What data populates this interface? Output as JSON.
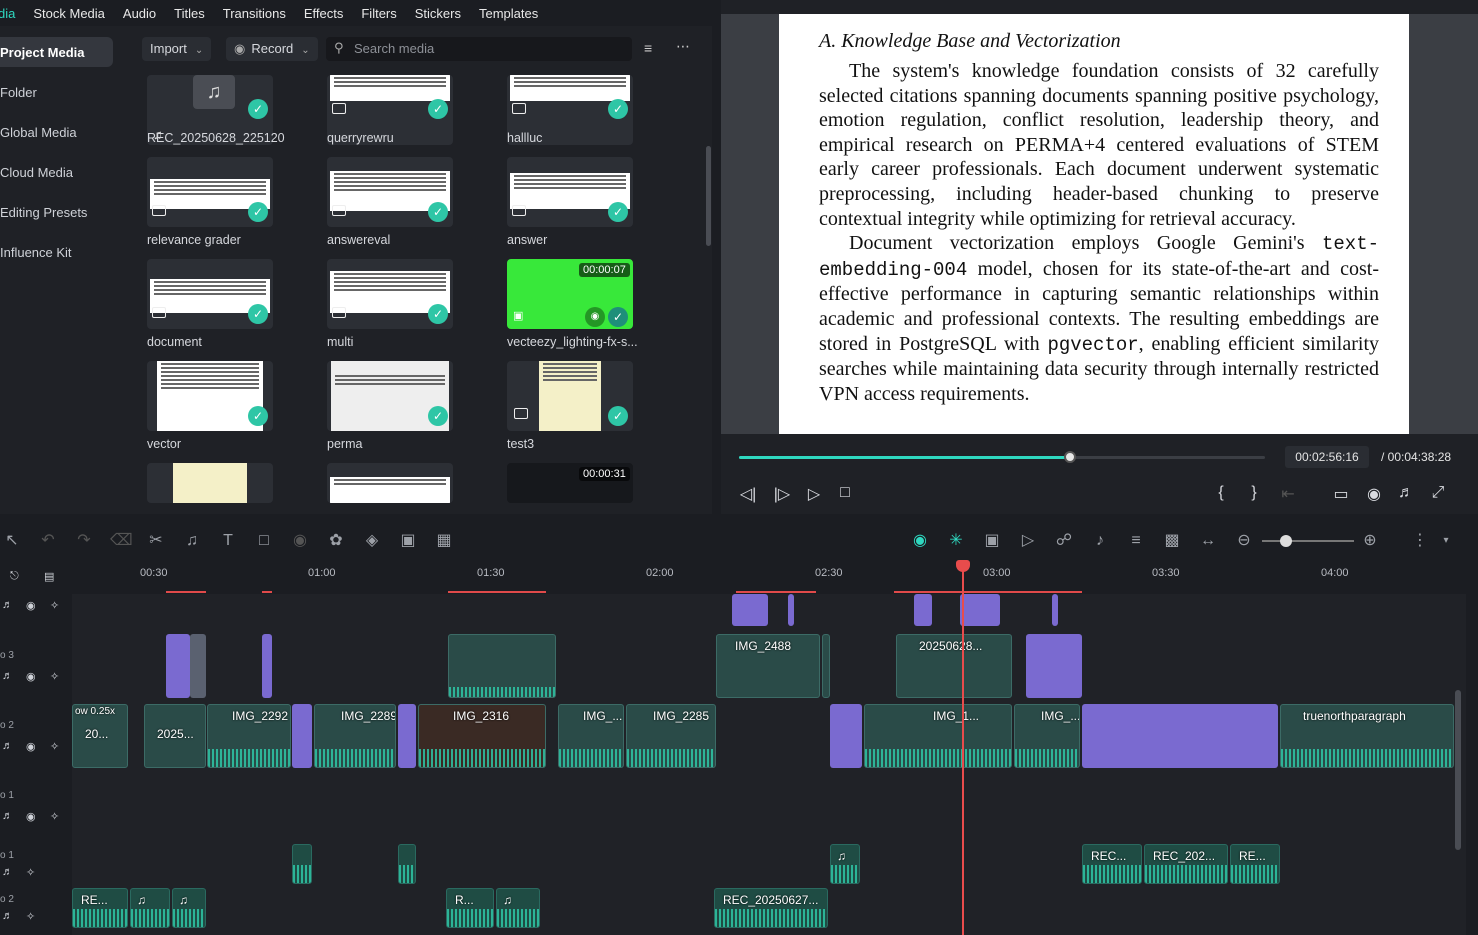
{
  "top_tabs": [
    "dia",
    "Stock Media",
    "Audio",
    "Titles",
    "Transitions",
    "Effects",
    "Filters",
    "Stickers",
    "Templates"
  ],
  "sidebar": [
    "Project Media",
    "Folder",
    "Global Media",
    "Cloud Media",
    "Editing Presets",
    "Influence Kit"
  ],
  "media_toolbar": {
    "import": "Import",
    "record": "Record",
    "search_placeholder": "Search media"
  },
  "media_items": [
    {
      "label": "REC_20250628_225120"
    },
    {
      "label": "querryrewru"
    },
    {
      "label": "hallluc"
    },
    {
      "label": "relevance grader"
    },
    {
      "label": "answereval"
    },
    {
      "label": "answer"
    },
    {
      "label": "document"
    },
    {
      "label": "multi"
    },
    {
      "label": "vecteezy_lighting-fx-s...",
      "duration": "00:00:07"
    },
    {
      "label": "vector"
    },
    {
      "label": "perma"
    },
    {
      "label": "test3"
    },
    {
      "label": "",
      "duration": "00:00:31"
    }
  ],
  "preview_doc": {
    "heading": "A. Knowledge Base and Vectorization",
    "p1": "The system's knowledge foundation consists of 32 carefully selected citations spanning documents spanning positive psychology, emotion regulation, conflict resolution, leadership theory, and empirical research on PERMA+4 centered evaluations of STEM early career professionals. Each document underwent systematic preprocessing, including header-based chunking to preserve contextual integrity while optimizing for retrieval accuracy.",
    "p2a": "Document vectorization employs Google Gemini's ",
    "p2code": "text-embedding-004",
    "p2b": " model, chosen for its state-of-the-art and cost-effective performance in capturing semantic relationships within academic and professional contexts. The resulting embeddings are stored in PostgreSQL with ",
    "p2code2": "pgvector",
    "p2c": ", enabling efficient similarity searches while maintaining data security through internally restricted VPN access requirements."
  },
  "playback": {
    "current": "00:02:56:16",
    "total": "/ 00:04:38:28",
    "progress": 0.63
  },
  "ruler": [
    "00:30",
    "01:00",
    "01:30",
    "02:00",
    "02:30",
    "03:00",
    "03:30",
    "04:00"
  ],
  "tracks": [
    "",
    "o 3",
    "o 2",
    "o 1",
    "o 1",
    "o 2"
  ],
  "clips": {
    "img2488": "IMG_2488",
    "c20250628": "20250628...",
    "slow": "ow 0.25x",
    "c20": "20...",
    "c2025": "2025...",
    "img2292": "IMG_2292",
    "img2289": "IMG_2289",
    "img2316": "IMG_2316",
    "img_": "IMG_...",
    "img2285": "IMG_2285",
    "img_1": "IMG_1...",
    "img_2": "IMG_...",
    "truenorth": "truenorthparagraph",
    "rec1": "REC...",
    "rec2": "REC_202...",
    "rec3": "RE...",
    "ra1": "RE...",
    "ra2": "R...",
    "ra3": "REC_20250627..."
  }
}
